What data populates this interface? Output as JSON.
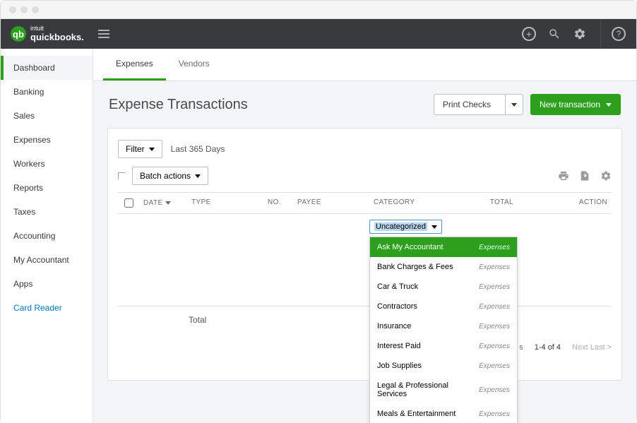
{
  "brand": {
    "intuit": "intuit",
    "product": "quickbooks."
  },
  "sidebar": {
    "items": [
      {
        "label": "Dashboard",
        "active": true
      },
      {
        "label": "Banking"
      },
      {
        "label": "Sales"
      },
      {
        "label": "Expenses"
      },
      {
        "label": "Workers"
      },
      {
        "label": "Reports"
      },
      {
        "label": "Taxes"
      },
      {
        "label": "Accounting"
      },
      {
        "label": "My Accountant"
      },
      {
        "label": "Apps"
      },
      {
        "label": "Card Reader",
        "link": true
      }
    ]
  },
  "tabs": [
    {
      "label": "Expenses",
      "active": true
    },
    {
      "label": "Vendors"
    }
  ],
  "page": {
    "title": "Expense Transactions"
  },
  "header_actions": {
    "print_checks": "Print Checks",
    "new_transaction": "New transaction"
  },
  "filters": {
    "filter_btn": "Filter",
    "range": "Last 365 Days",
    "batch": "Batch actions"
  },
  "columns": {
    "date": "DATE",
    "type": "TYPE",
    "no": "NO.",
    "payee": "PAYEE",
    "category": "CATEGORY",
    "total": "TOTAL",
    "action": "ACTION"
  },
  "category_select": {
    "value": "Uncategorized"
  },
  "category_options": [
    {
      "name": "Ask My Accountant",
      "type": "Expenses",
      "highlighted": true
    },
    {
      "name": "Bank Charges & Fees",
      "type": "Expenses"
    },
    {
      "name": "Car & Truck",
      "type": "Expenses"
    },
    {
      "name": "Contractors",
      "type": "Expenses"
    },
    {
      "name": "Insurance",
      "type": "Expenses"
    },
    {
      "name": "Interest Paid",
      "type": "Expenses"
    },
    {
      "name": "Job Supplies",
      "type": "Expenses"
    },
    {
      "name": "Legal & Professional Services",
      "type": "Expenses"
    },
    {
      "name": "Meals & Entertainment",
      "type": "Expenses"
    }
  ],
  "total_row": "Total",
  "pager": {
    "prefix": "s",
    "range": "1-4 of 4",
    "next": "Next Last >"
  }
}
